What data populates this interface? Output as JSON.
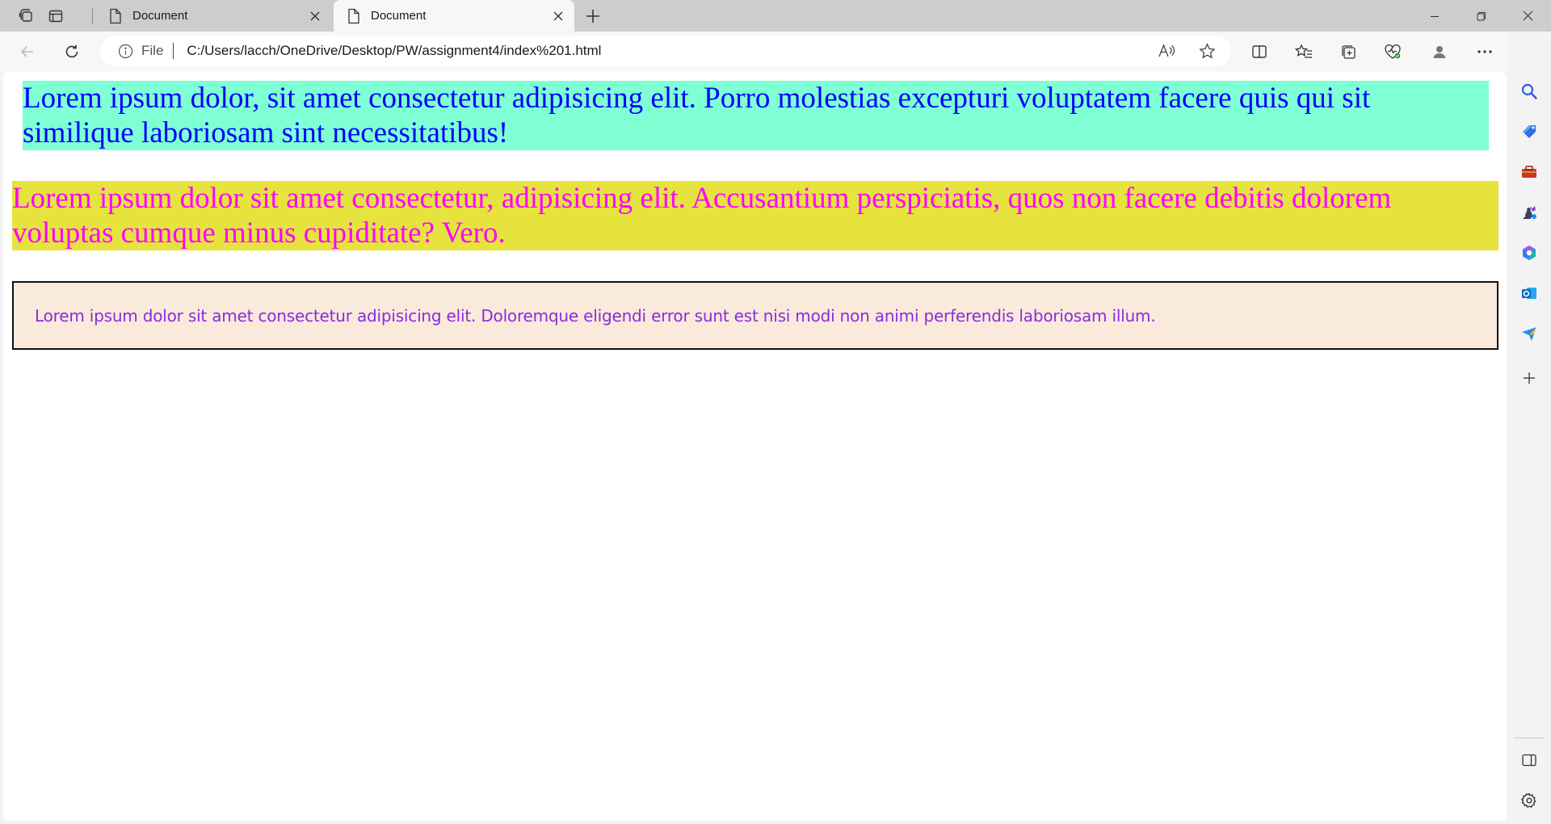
{
  "browser": {
    "tabs": [
      {
        "title": "Document",
        "active": false
      },
      {
        "title": "Document",
        "active": true
      }
    ],
    "address": {
      "scheme_label": "File",
      "url": "C:/Users/lacch/OneDrive/Desktop/PW/assignment4/index%201.html"
    },
    "accent_color": "#0f6cbd"
  },
  "page": {
    "box1": {
      "text": "Lorem ipsum dolor, sit amet consectetur adipisicing elit. Porro molestias excepturi voluptatem facere quis qui sit similique laboriosam sint necessitatibus!",
      "background": "#7fffd4",
      "color": "#0000ff"
    },
    "box2": {
      "text": "Lorem ipsum dolor sit amet consectetur, adipisicing elit. Accusantium perspiciatis, quos non facere debitis dolorem voluptas cumque minus cupiditate? Vero.",
      "background": "#e6e33f",
      "color": "#ff00ff"
    },
    "box3": {
      "text": "Lorem ipsum dolor sit amet consectetur adipisicing elit. Doloremque eligendi error sunt est nisi modi non animi perferendis laboriosam illum.",
      "background": "#f9eadb",
      "color": "#8a2be2"
    }
  },
  "icons": {
    "tab_actions": "tab-actions-icon",
    "vertical_tabs": "vertical-tabs-icon",
    "back": "back-arrow-icon",
    "refresh": "refresh-icon",
    "info": "info-icon",
    "read_aloud": "read-aloud-icon",
    "favorite": "star-icon",
    "split": "split-screen-icon",
    "favorites": "favorites-icon",
    "collections": "collections-icon",
    "performance": "browser-essentials-icon",
    "profile": "profile-icon",
    "more": "more-icon",
    "copilot": "copilot-icon",
    "sidebar": [
      "search-icon",
      "shopping-icon",
      "tools-icon",
      "games-icon",
      "microsoft365-icon",
      "outlook-icon",
      "send-icon",
      "add-icon",
      "hide-sidebar-icon",
      "settings-icon"
    ]
  }
}
